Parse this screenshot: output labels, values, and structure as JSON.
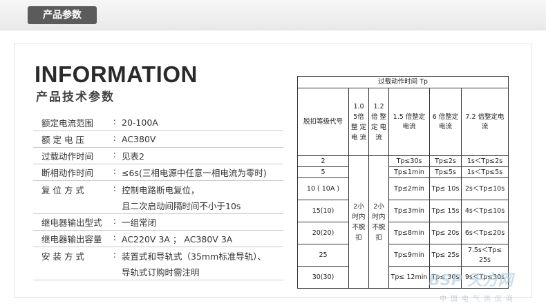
{
  "header": {
    "tab_label": "产品参数"
  },
  "info": {
    "title": "INFORMATION",
    "subtitle": "产品技术参数"
  },
  "specs": [
    {
      "label": "额定电流范围",
      "value": "20-100A"
    },
    {
      "label": "额 定 电 压",
      "value": "AC380V"
    },
    {
      "label": "过载动作时间",
      "value": "见表2"
    },
    {
      "label": "断相动作时间",
      "value": "≤6s(三相电源中任意一相电流为零时)"
    },
    {
      "label": "复 位 方 式",
      "value": "控制电路断电复位，"
    },
    {
      "label": "",
      "value": "且二次启动间隔时间不小于10s"
    },
    {
      "label": "继电器输出型式",
      "value": "一组常闭"
    },
    {
      "label": "继电器输出容量",
      "value": "AC220V  3A ；    AC380V  3A"
    },
    {
      "label": "安 装 方 式",
      "value": "装置式和导轨式（35mm标准导轨）、"
    },
    {
      "label": "",
      "value": "导轨式订购时需注明"
    }
  ],
  "table": {
    "title": "过载动作时间 Tp",
    "col_code": "脱扣等级代号",
    "col_10": "1.0 5倍 整 定 电 流",
    "col_12": "1.2 倍 整 定 电 流",
    "col_15": "1.5 倍整定电流",
    "col_6": "6 倍整定电流",
    "col_72": "7.2 倍整定电流",
    "merged": "2小时内不脱扣",
    "rows": [
      {
        "code": "2",
        "c15": "Tp≤30s",
        "c6": "Tp≤2s",
        "c72": "1s＜Tp≤2s"
      },
      {
        "code": "5",
        "c15": "Tp≤1min",
        "c6": "Tp≤5s",
        "c72": "1s＜Tp≤5s"
      },
      {
        "code": "10 ( 10A )",
        "c15": "Tp≤2min",
        "c6": "Tp≤ 10s",
        "c72": "2s＜Tp≤10s"
      },
      {
        "code": "15(10)",
        "c15": "Tp≤3min",
        "c6": "Tp≤ 15s",
        "c72": "4s＜Tp≤10s"
      },
      {
        "code": "20(20)",
        "c15": "Tp≤8min",
        "c6": "Tp≤ 20s",
        "c72": "6s＜Tp≤20s"
      },
      {
        "code": "25",
        "c15": "Tp≤9min",
        "c6": "Tp≤ 25s",
        "c72": "7.5s＜Tp≤ 25s"
      },
      {
        "code": "30(30)",
        "c15": "Tp≤ 12min",
        "c6": "Tp≤ 30s",
        "c72": "9s＜Tp≤30s"
      }
    ]
  },
  "watermark": {
    "brand": "BSP 天方网",
    "tagline": "中国电气供应商"
  }
}
